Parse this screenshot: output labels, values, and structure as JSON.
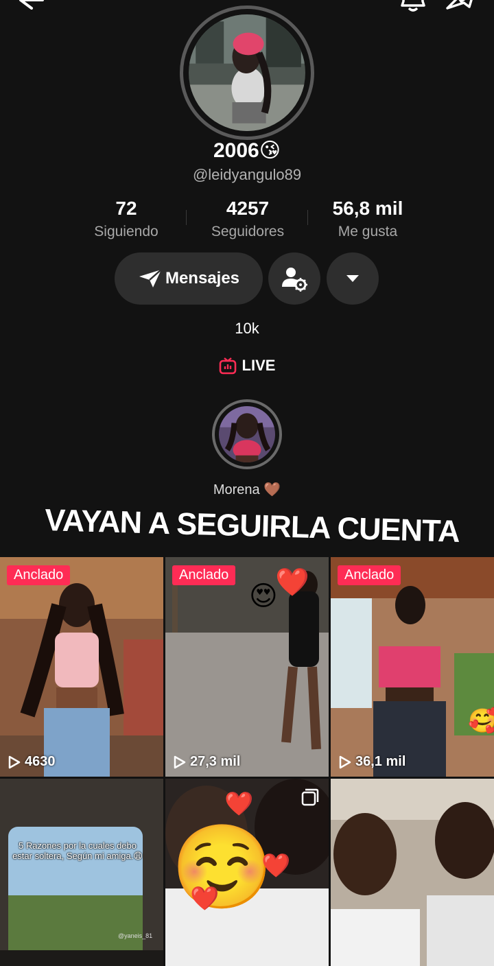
{
  "profile": {
    "display_name": "2006😘",
    "handle": "@leidyangulo89",
    "bio": "10k"
  },
  "stats": [
    {
      "value": "72",
      "label": "Siguiendo"
    },
    {
      "value": "4257",
      "label": "Seguidores"
    },
    {
      "value": "56,8 mil",
      "label": "Me gusta"
    }
  ],
  "actions": {
    "message_label": "Mensajes"
  },
  "live": {
    "label": "LIVE"
  },
  "story": {
    "label": "Morena 🤎"
  },
  "overlay_text": "VAYAN A SEGUIRLA CUENTA",
  "videos": [
    {
      "pinned": true,
      "pinned_label": "Anclado",
      "views": "4630"
    },
    {
      "pinned": true,
      "pinned_label": "Anclado",
      "views": "27,3 mil"
    },
    {
      "pinned": true,
      "pinned_label": "Anclado",
      "views": "36,1 mil"
    },
    {
      "pinned": false,
      "caption": "5 Razones por la cuales debo estar soltera, Según mi amiga.😩",
      "watermark": "@yaneis_81"
    },
    {
      "pinned": false
    },
    {
      "pinned": false
    }
  ],
  "colors": {
    "background": "#121212",
    "accent": "#fe2c55",
    "button_bg": "#2e2e2e"
  },
  "icons": [
    "back-icon",
    "bell-icon",
    "share-icon",
    "send-icon",
    "add-friend-settings-icon",
    "caret-down-icon",
    "live-tv-icon",
    "play-icon",
    "multi-photo-icon"
  ]
}
